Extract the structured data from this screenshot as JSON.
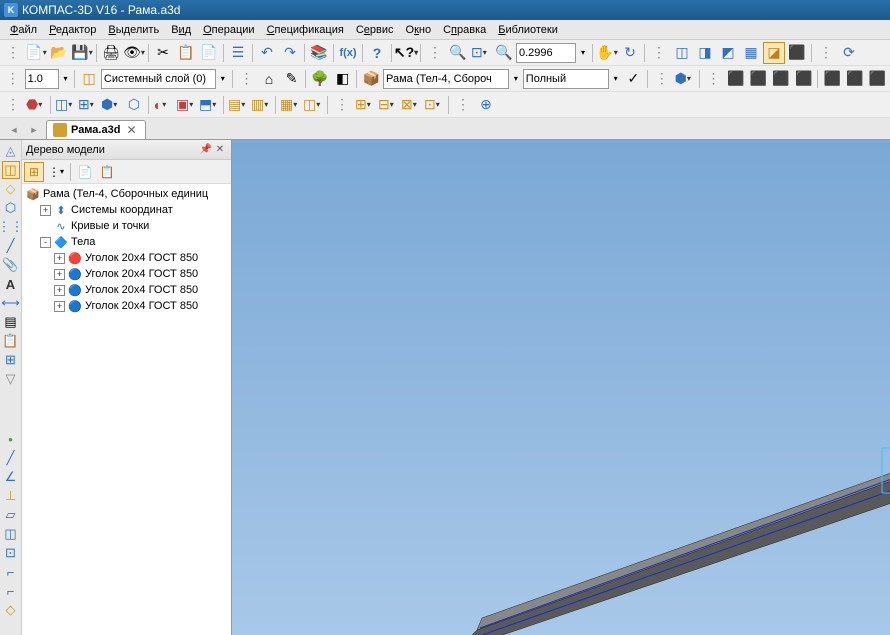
{
  "title": "КОМПАС-3D V16  - Рама.a3d",
  "menu": [
    "Файл",
    "Редактор",
    "Выделить",
    "Вид",
    "Операции",
    "Спецификация",
    "Сервис",
    "Окно",
    "Справка",
    "Библиотеки"
  ],
  "menu_chars": [
    "Ф",
    "Р",
    "В",
    "и",
    "О",
    "С",
    "е",
    "к",
    "п",
    "Б"
  ],
  "layer_value": "1.0",
  "layer_combo": "Системный слой (0)",
  "doc_combo": "Рама (Тел-4, Сбороч",
  "view_style": "Полный",
  "zoom_value": "0.2996",
  "active_tab": "Рама.a3d",
  "tree": {
    "title": "Дерево модели",
    "root": "Рама (Тел-4, Сборочных единиц",
    "nodes": [
      {
        "label": "Системы координат",
        "icon": "coord",
        "expand": "+",
        "indent": 1
      },
      {
        "label": "Кривые и точки",
        "icon": "curve",
        "expand": "",
        "indent": 1
      },
      {
        "label": "Тела",
        "icon": "body",
        "expand": "-",
        "indent": 1
      },
      {
        "label": "Уголок  20x4 ГОСТ 850",
        "icon": "body-red",
        "expand": "+",
        "indent": 2
      },
      {
        "label": "Уголок  20x4 ГОСТ 850",
        "icon": "body-blue",
        "expand": "+",
        "indent": 2
      },
      {
        "label": "Уголок  20x4 ГОСТ 850",
        "icon": "body-blue",
        "expand": "+",
        "indent": 2
      },
      {
        "label": "Уголок  20x4 ГОСТ 850",
        "icon": "body-blue",
        "expand": "+",
        "indent": 2
      }
    ]
  }
}
